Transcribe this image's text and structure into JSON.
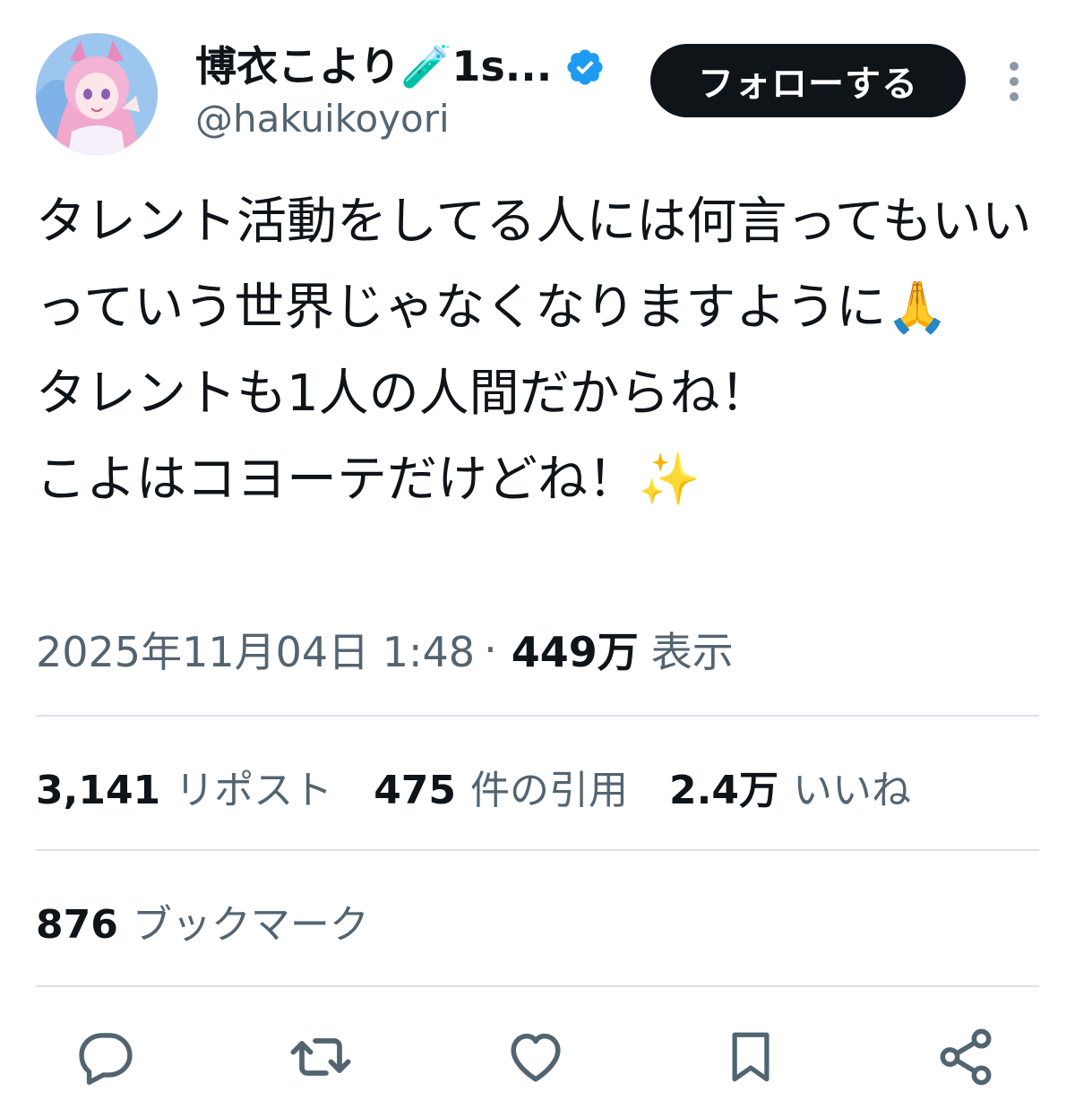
{
  "author": {
    "display_name": "博衣こより🧪1s...",
    "handle": "@hakuikoyori",
    "verified": true,
    "follow_label": "フォローする",
    "avatar_icon": "avatar-image"
  },
  "tweet": {
    "text": "タレント活動をしてる人には何言ってもいいっていう世界じゃなくなりますように🙏\nタレントも1人の人間だからね！\nこよはコヨーテだけどね！✨"
  },
  "meta": {
    "timestamp": "2025年11月04日 1:48",
    "separator": "·",
    "views_count": "449万",
    "views_label": "表示"
  },
  "stats": [
    {
      "count": "3,141",
      "label": "リポスト"
    },
    {
      "count": "475",
      "label": "件の引用"
    },
    {
      "count": "2.4万",
      "label": "いいね"
    }
  ],
  "bookmarks": {
    "count": "876",
    "label": "ブックマーク"
  },
  "actions": {
    "reply_icon": "reply-icon",
    "retweet_icon": "retweet-icon",
    "like_icon": "heart-icon",
    "bookmark_icon": "bookmark-icon",
    "share_icon": "share-icon"
  },
  "colors": {
    "text": "#0f1419",
    "secondary": "#536471",
    "verified": "#1d9bf0",
    "button": "#0f1419",
    "divider": "#dbe1e6"
  }
}
